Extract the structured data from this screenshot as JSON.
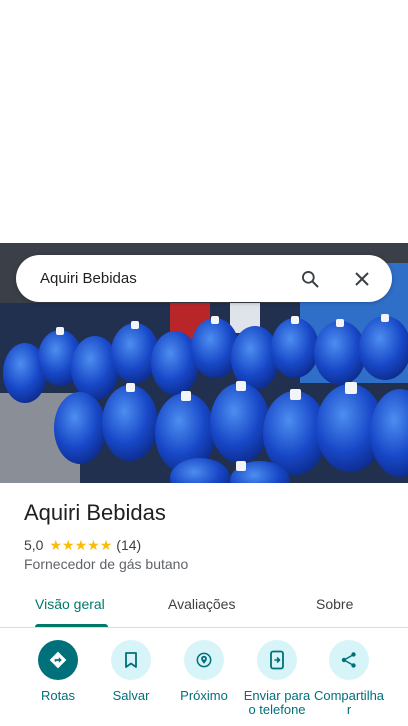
{
  "search": {
    "query": "Aquiri Bebidas"
  },
  "place": {
    "name": "Aquiri Bebidas",
    "rating": "5,0",
    "stars": [
      "★",
      "★",
      "★",
      "★",
      "★"
    ],
    "review_count": "(14)",
    "category": "Fornecedor de gás butano"
  },
  "tabs": [
    {
      "label": "Visão geral",
      "active": true
    },
    {
      "label": "Avaliações",
      "active": false
    },
    {
      "label": "Sobre",
      "active": false
    }
  ],
  "actions": [
    {
      "label": "Rotas",
      "icon": "directions-icon"
    },
    {
      "label": "Salvar",
      "icon": "bookmark-icon"
    },
    {
      "label": "Próximo",
      "icon": "nearby-icon"
    },
    {
      "label": "Enviar para o telefone",
      "icon": "send-to-phone-icon"
    },
    {
      "label": "Compartilhar",
      "icon": "share-icon"
    }
  ],
  "colors": {
    "accent": "#00707a",
    "action_bg": "#d7f4f8",
    "star": "#fbbc04"
  }
}
